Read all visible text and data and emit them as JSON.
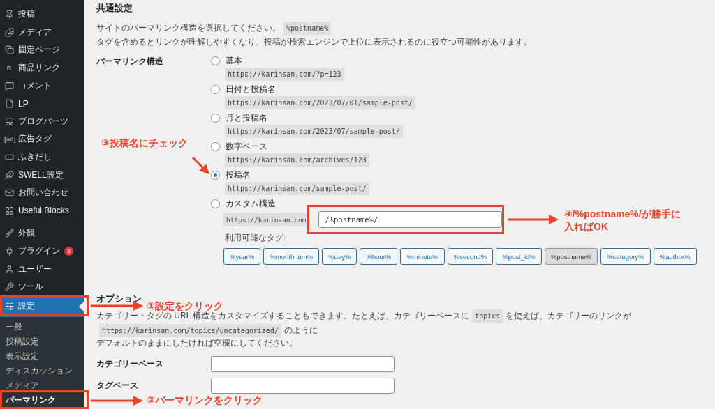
{
  "sidebar": {
    "groups": [
      {
        "items": [
          {
            "label": "投稿",
            "selected": false
          },
          {
            "label": "メディア",
            "selected": false
          },
          {
            "label": "固定ページ",
            "selected": false
          },
          {
            "label": "商品リンク",
            "icon_text": "R",
            "selected": false
          },
          {
            "label": "コメント",
            "selected": false
          },
          {
            "label": "LP",
            "selected": false
          },
          {
            "label": "ブログパーツ",
            "selected": false
          },
          {
            "label": "広告タグ",
            "icon_text": "[ad]",
            "selected": false
          },
          {
            "label": "ふきだし",
            "selected": false
          },
          {
            "label": "SWELL設定",
            "selected": false
          },
          {
            "label": "お問い合わせ",
            "selected": false
          },
          {
            "label": "Useful Blocks",
            "selected": false
          }
        ]
      },
      {
        "items": [
          {
            "label": "外観",
            "selected": false
          },
          {
            "label": "プラグイン",
            "badge": "3",
            "selected": false
          },
          {
            "label": "ユーザー",
            "selected": false
          },
          {
            "label": "ツール",
            "selected": false
          },
          {
            "label": "設定",
            "selected": true
          }
        ]
      }
    ],
    "submenu": [
      {
        "label": "一般",
        "selected": false
      },
      {
        "label": "投稿設定",
        "selected": false
      },
      {
        "label": "表示設定",
        "selected": false
      },
      {
        "label": "ディスカッション",
        "selected": false
      },
      {
        "label": "メディア",
        "selected": false
      },
      {
        "label": "パーマリンク",
        "selected": true
      }
    ]
  },
  "common": {
    "heading": "共通設定",
    "description": [
      {
        "text": "サイトのパーマリンク構造を選択してください。",
        "code": false
      },
      {
        "text": "%postname%",
        "code": true
      },
      {
        "text": "タグを含めるとリンクが理解しやすくなり、投稿が検索エンジンで上位に表示されるのに役立つ可能性があります。",
        "code": false
      }
    ],
    "field_label": "パーマリンク構造",
    "options": [
      {
        "label": "基本",
        "url": "https://karinsan.com/?p=123",
        "selected": false
      },
      {
        "label": "日付と投稿名",
        "url": "https://karinsan.com/2023/07/01/sample-post/",
        "selected": false
      },
      {
        "label": "月と投稿名",
        "url": "https://karinsan.com/2023/07/sample-post/",
        "selected": false
      },
      {
        "label": "数字ベース",
        "url": "https://karinsan.com/archives/123",
        "selected": false
      },
      {
        "label": "投稿名",
        "url": "https://karinsan.com/sample-post/",
        "selected": true
      }
    ],
    "custom": {
      "label": "カスタム構造",
      "selected": false,
      "prefix": "https://karinsan.com",
      "value": "/%postname%/",
      "tags_label": "利用可能なタグ:",
      "tags": [
        {
          "label": "%year%",
          "selected": false
        },
        {
          "label": "%monthnum%",
          "selected": false
        },
        {
          "label": "%day%",
          "selected": false
        },
        {
          "label": "%hour%",
          "selected": false
        },
        {
          "label": "%minute%",
          "selected": false
        },
        {
          "label": "%second%",
          "selected": false
        },
        {
          "label": "%post_id%",
          "selected": false
        },
        {
          "label": "%postname%",
          "selected": true
        },
        {
          "label": "%category%",
          "selected": false
        },
        {
          "label": "%author%",
          "selected": false
        }
      ]
    }
  },
  "optional": {
    "heading": "オプション",
    "description_lines": [
      [
        {
          "text": "カテゴリー・タグの URL 構造をカスタマイズすることもできます。たとえば、カテゴリーベースに",
          "code": false
        },
        {
          "text": "topics",
          "code": true
        },
        {
          "text": "を使えば、カテゴリーのリンクが",
          "code": false
        },
        {
          "text": "https://karinsan.com/topics/uncategorized/",
          "code": true
        },
        {
          "text": "のように",
          "code": false
        }
      ],
      [
        {
          "text": "デフォルトのままにしたければ空欄にしてください。",
          "code": false
        }
      ]
    ],
    "fields": [
      {
        "label": "カテゴリーベース"
      },
      {
        "label": "タグベース"
      }
    ]
  },
  "annotations": [
    {
      "kind": "check",
      "lines": [
        "③投稿名にチェック"
      ]
    },
    {
      "kind": "field",
      "lines": [
        "④/%postname%/が勝手に",
        "入ればOK"
      ]
    },
    {
      "kind": "settings",
      "lines": [
        "①設定をクリック"
      ]
    },
    {
      "kind": "permalink",
      "lines": [
        "②パーマリンクをクリック"
      ]
    }
  ]
}
